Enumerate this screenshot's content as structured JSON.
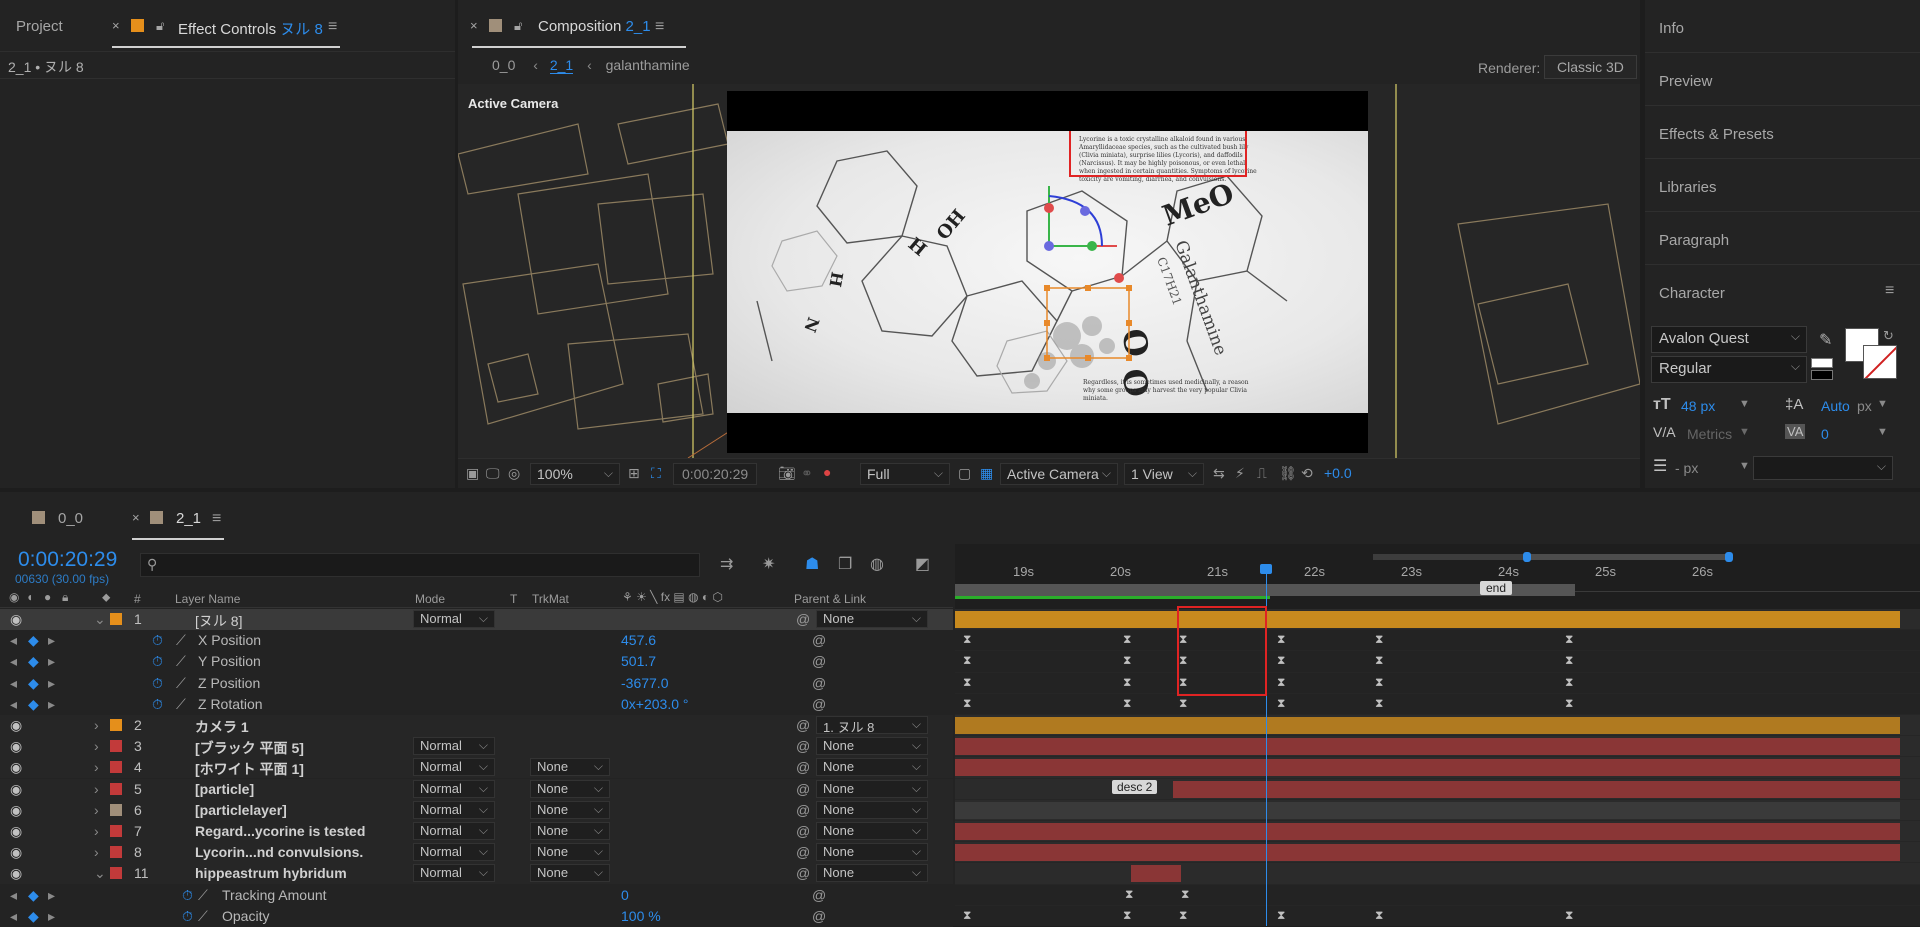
{
  "left_panel": {
    "tab_project": "Project",
    "tab_effect_controls": "Effect Controls",
    "tab_effect_controls_target": "ヌル 8",
    "subtitle": "2_1 • ヌル 8",
    "colors": {
      "label_orange": "#e58f1b"
    }
  },
  "composition": {
    "tab_label": "Composition",
    "tab_target": "2_1",
    "breadcrumb": [
      "0_0",
      "2_1",
      "galanthamine"
    ],
    "renderer_label": "Renderer:",
    "renderer_value": "Classic 3D",
    "view_label": "Active Camera",
    "text_top": "Lycorine is a toxic crystalline alkaloid found in various Amaryllidaceae species, such as the cultivated bush lily (Clivia miniata), surprise lilies (Lycoris), and daffodils (Narcissus). It may be highly poisonous, or even lethal, when ingested in certain quantities. Symptoms of lycorine toxicity are vomiting, diarrhea, and convulsions.",
    "text_bottom": "Regardless, it is sometimes used medicinally, a reason why some groups may harvest the very popular Clivia miniata.",
    "molecule_name": "Galanthamine",
    "molecule_formula": "C17H21",
    "toolbar": {
      "zoom": "100%",
      "timecode": "0:00:20:29",
      "resolution": "Full",
      "camera": "Active Camera",
      "views": "1 View",
      "exposure": "+0.0"
    }
  },
  "right_panel": {
    "items": [
      "Info",
      "Preview",
      "Effects & Presets",
      "Libraries",
      "Paragraph",
      "Character"
    ],
    "character": {
      "font": "Avalon Quest",
      "style": "Regular",
      "font_size": "48 px",
      "leading": "Auto",
      "leading_unit": "px",
      "kerning": "Metrics",
      "tracking": "0",
      "stroke_width": "- px"
    }
  },
  "timeline": {
    "tabs": [
      {
        "label": "0_0"
      },
      {
        "label": "2_1"
      }
    ],
    "timecode": "0:00:20:29",
    "frame_info": "00630 (30.00 fps)",
    "headers": {
      "layer_name": "Layer Name",
      "mode": "Mode",
      "t": "T",
      "trkmat": "TrkMat",
      "parent": "Parent & Link",
      "num": "#"
    },
    "ruler": [
      "19s",
      "20s",
      "21s",
      "22s",
      "23s",
      "24s",
      "25s",
      "26s"
    ],
    "marker_end": "end",
    "marker_desc2": "desc 2",
    "layers": [
      {
        "num": "1",
        "name": "[ヌル 8]",
        "mode": "Normal",
        "trkmat": "",
        "parent": "None",
        "color": "#e58f1b"
      },
      {
        "num": "",
        "name": "X Position",
        "value": "457.6"
      },
      {
        "num": "",
        "name": "Y Position",
        "value": "501.7"
      },
      {
        "num": "",
        "name": "Z Position",
        "value": "-3677.0"
      },
      {
        "num": "",
        "name": "Z Rotation",
        "value": "0x+203.0 °"
      },
      {
        "num": "2",
        "name": "カメラ 1",
        "mode": "",
        "trkmat": "",
        "parent": "1. ヌル 8",
        "color": "#e58f1b"
      },
      {
        "num": "3",
        "name": "[ブラック 平面 5]",
        "mode": "Normal",
        "trkmat": "",
        "parent": "None",
        "color": "#c23a3a"
      },
      {
        "num": "4",
        "name": "[ホワイト 平面 1]",
        "mode": "Normal",
        "trkmat": "None",
        "parent": "None",
        "color": "#c23a3a"
      },
      {
        "num": "5",
        "name": "[particle]",
        "mode": "Normal",
        "trkmat": "None",
        "parent": "None",
        "color": "#c23a3a"
      },
      {
        "num": "6",
        "name": "[particlelayer]",
        "mode": "Normal",
        "trkmat": "None",
        "parent": "None",
        "color": "#a08f7a"
      },
      {
        "num": "7",
        "name": "Regard...ycorine is tested",
        "mode": "Normal",
        "trkmat": "None",
        "parent": "None",
        "color": "#c23a3a"
      },
      {
        "num": "8",
        "name": "Lycorin...nd convulsions.",
        "mode": "Normal",
        "trkmat": "None",
        "parent": "None",
        "color": "#c23a3a"
      },
      {
        "num": "11",
        "name": "hippeastrum hybridum",
        "mode": "Normal",
        "trkmat": "None",
        "parent": "None",
        "color": "#c23a3a"
      },
      {
        "num": "",
        "name": "Tracking Amount",
        "value": "0"
      },
      {
        "num": "",
        "name": "Opacity",
        "value": "100 %"
      }
    ]
  }
}
